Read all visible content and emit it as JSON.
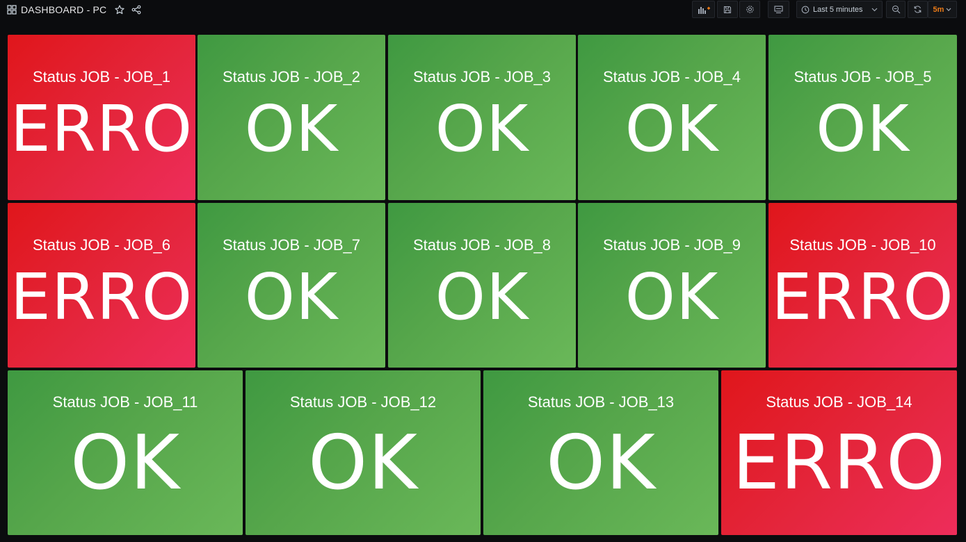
{
  "header": {
    "title": "DASHBOARD - PC",
    "time_range": "Last 5 minutes",
    "refresh_interval": "5m"
  },
  "colors": {
    "ok": "#56a64b",
    "erro": "#e4263d",
    "refresh_accent": "#eb7b18",
    "background": "#0b0c0e"
  },
  "panels": [
    {
      "title": "Status JOB - JOB_1",
      "value": "ERRO",
      "state": "erro"
    },
    {
      "title": "Status JOB - JOB_2",
      "value": "OK",
      "state": "ok"
    },
    {
      "title": "Status JOB - JOB_3",
      "value": "OK",
      "state": "ok"
    },
    {
      "title": "Status JOB - JOB_4",
      "value": "OK",
      "state": "ok"
    },
    {
      "title": "Status JOB - JOB_5",
      "value": "OK",
      "state": "ok"
    },
    {
      "title": "Status JOB - JOB_6",
      "value": "ERRO",
      "state": "erro"
    },
    {
      "title": "Status JOB - JOB_7",
      "value": "OK",
      "state": "ok"
    },
    {
      "title": "Status JOB - JOB_8",
      "value": "OK",
      "state": "ok"
    },
    {
      "title": "Status JOB - JOB_9",
      "value": "OK",
      "state": "ok"
    },
    {
      "title": "Status JOB - JOB_10",
      "value": "ERRO",
      "state": "erro"
    },
    {
      "title": "Status JOB - JOB_11",
      "value": "OK",
      "state": "ok"
    },
    {
      "title": "Status JOB - JOB_12",
      "value": "OK",
      "state": "ok"
    },
    {
      "title": "Status JOB - JOB_13",
      "value": "OK",
      "state": "ok"
    },
    {
      "title": "Status JOB - JOB_14",
      "value": "ERRO",
      "state": "erro"
    }
  ]
}
